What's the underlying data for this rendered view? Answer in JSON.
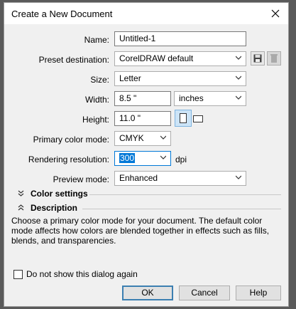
{
  "window": {
    "title": "Create a New Document"
  },
  "form": {
    "name_label": "Name:",
    "name_value": "Untitled-1",
    "preset_label": "Preset destination:",
    "preset_value": "CorelDRAW default",
    "size_label": "Size:",
    "size_value": "Letter",
    "width_label": "Width:",
    "width_value": "8.5 \"",
    "units_value": "inches",
    "height_label": "Height:",
    "height_value": "11.0 \"",
    "color_mode_label": "Primary color mode:",
    "color_mode_value": "CMYK",
    "resolution_label": "Rendering resolution:",
    "resolution_value": "300",
    "resolution_unit": "dpi",
    "preview_label": "Preview mode:",
    "preview_value": "Enhanced"
  },
  "sections": {
    "color_settings": "Color settings",
    "description": "Description",
    "description_text": "Choose a primary color mode for your document. The default color mode affects how colors are blended together in effects such as fills, blends, and transparencies."
  },
  "footer": {
    "checkbox_label": "Do not show this dialog again",
    "ok": "OK",
    "cancel": "Cancel",
    "help": "Help"
  },
  "icons": [
    "close-icon",
    "save-preset-icon",
    "delete-preset-icon",
    "portrait-icon",
    "landscape-icon",
    "chevron-down-icon",
    "expand-chevron-icon",
    "collapse-chevron-icon"
  ]
}
